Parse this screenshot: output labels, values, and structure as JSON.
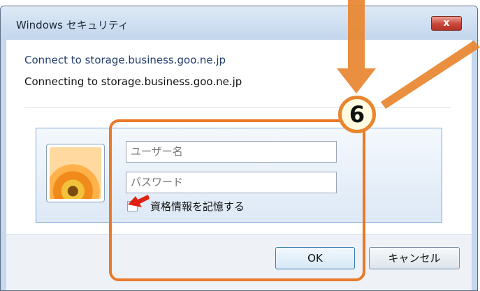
{
  "dialog": {
    "title": "Windows セキュリティ",
    "close_label": "x",
    "message_line1": "Connect to storage.business.goo.ne.jp",
    "message_line2": "Connecting to storage.business.goo.ne.jp"
  },
  "credentials": {
    "username_placeholder": "ユーザー名",
    "password_placeholder": "パスワード",
    "remember_label": "資格情報を記憶する",
    "remember_checked": false
  },
  "buttons": {
    "ok_label": "OK",
    "cancel_label": "キャンセル"
  },
  "annotation": {
    "step_number": "6",
    "accent_color": "#e87a2a",
    "pointer_color": "#e02010"
  }
}
